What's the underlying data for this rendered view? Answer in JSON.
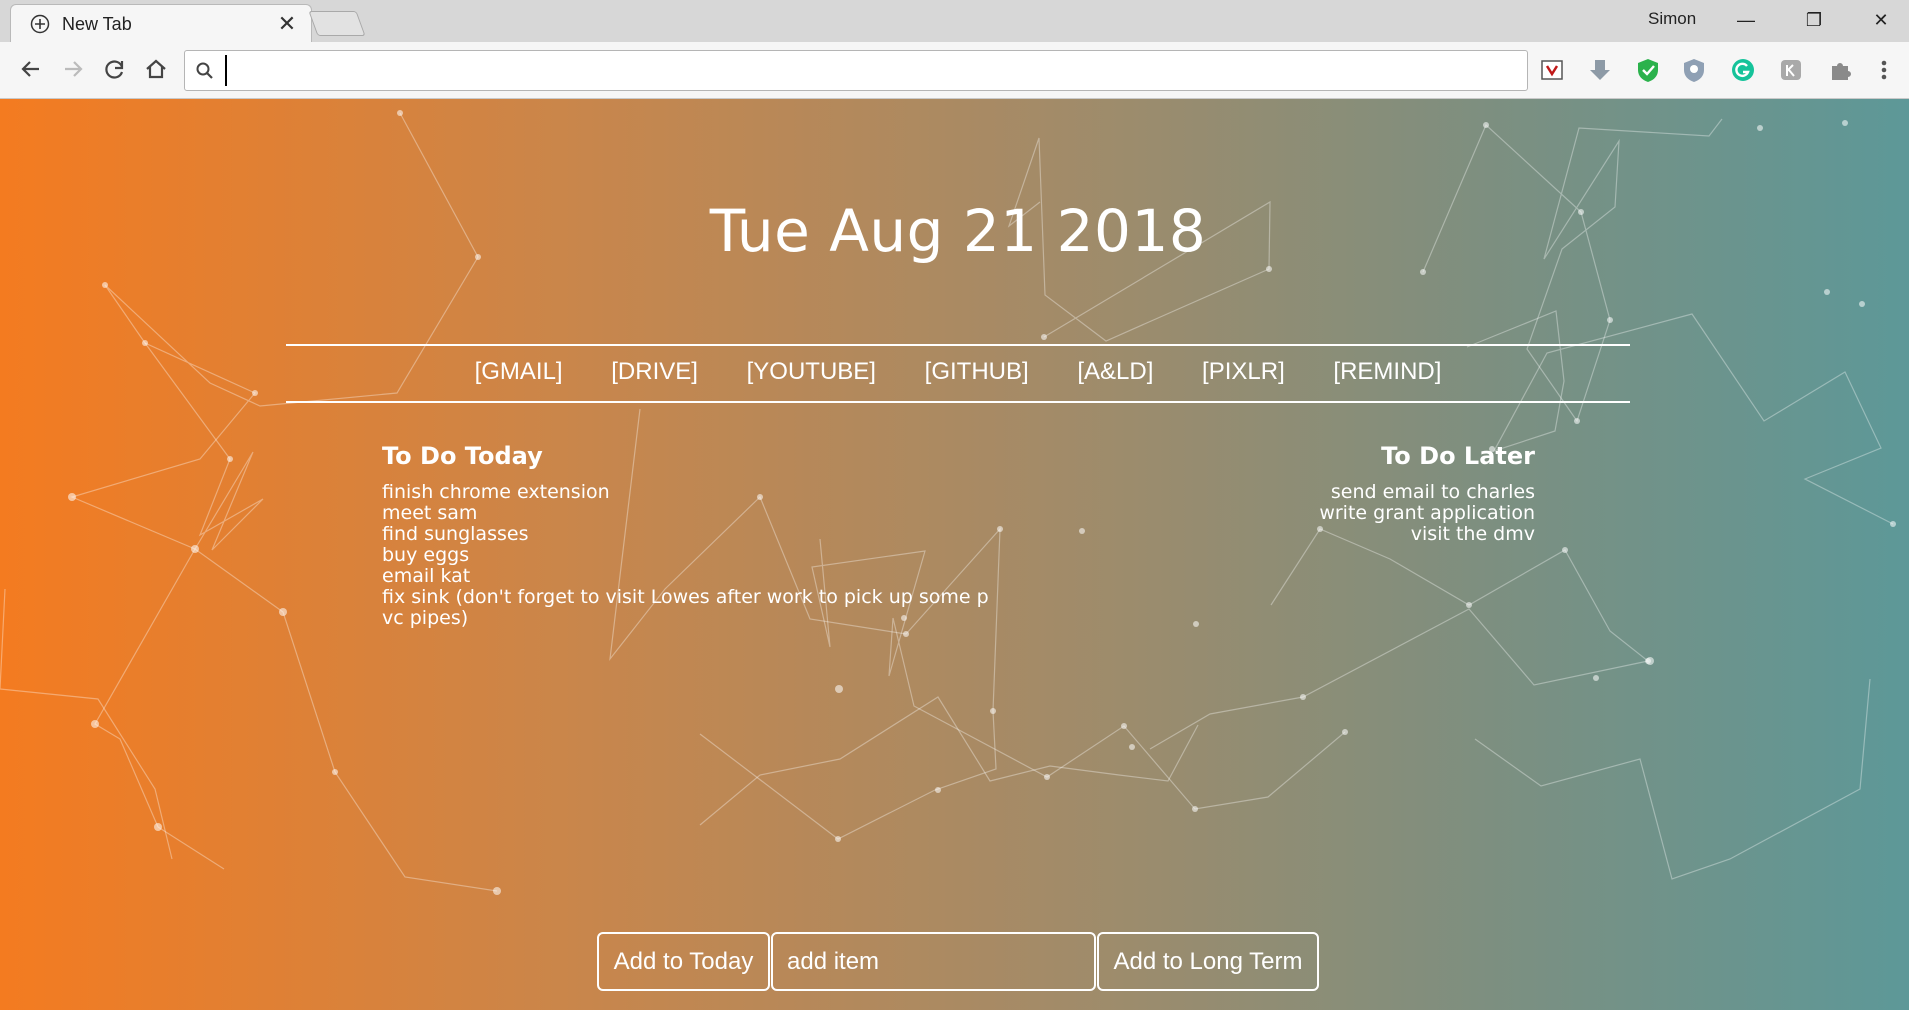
{
  "browser": {
    "tab_title": "New Tab",
    "tab_close": "✕",
    "profile_name": "Simon",
    "window_controls": [
      "—",
      "❐",
      "✕"
    ],
    "address_placeholder": ""
  },
  "page": {
    "date": "Tue Aug 21 2018",
    "links": [
      "[GMAIL]",
      "[DRIVE]",
      "[YOUTUBE]",
      "[GITHUB]",
      "[A&LD]",
      "[PIXLR]",
      "[REMIND]"
    ],
    "today_title": "To Do Today",
    "today_items": [
      "finish chrome extension",
      "meet sam",
      "find sunglasses",
      "buy eggs",
      "email kat",
      "fix sink (don't forget to visit Lowes after work to pick up some p",
      "vc pipes)"
    ],
    "later_title": "To Do Later",
    "later_items": [
      "send email to charles",
      "write grant application",
      "visit the dmv"
    ],
    "add_today_label": "Add to Today",
    "item_placeholder": "add item",
    "add_long_term_label": "Add to Long Term"
  },
  "colors": {
    "gradient_start": "#f47b20",
    "gradient_end": "#5d9898",
    "text": "#ffffff"
  },
  "icons": [
    "new-tab-icon",
    "back-arrow-icon",
    "forward-arrow-icon",
    "reload-icon",
    "home-icon",
    "search-icon",
    "mcafee-icon",
    "download-icon",
    "shield-icon",
    "privacy-icon",
    "grammarly-icon",
    "keyboard-icon",
    "puzzle-icon",
    "menu-icon"
  ]
}
